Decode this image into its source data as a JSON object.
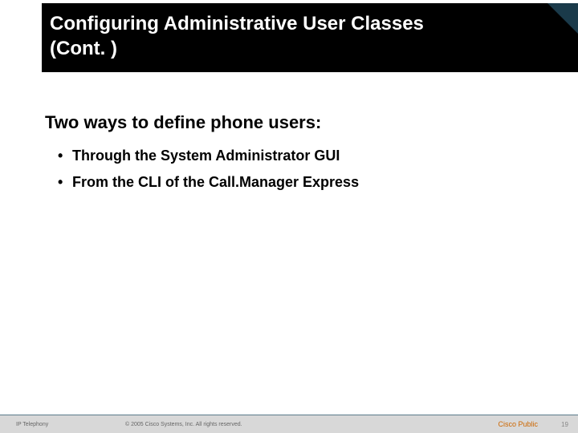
{
  "title": {
    "line1": "Configuring Administrative User Classes",
    "line2": "(Cont. )"
  },
  "subtitle": "Two ways to define phone users:",
  "bullets": [
    "Through the System Administrator GUI",
    "From the CLI of the Call.Manager Express"
  ],
  "footer": {
    "left": "IP Telephony",
    "center": "© 2005 Cisco Systems, Inc. All rights reserved.",
    "right": "Cisco Public",
    "page": "19"
  }
}
